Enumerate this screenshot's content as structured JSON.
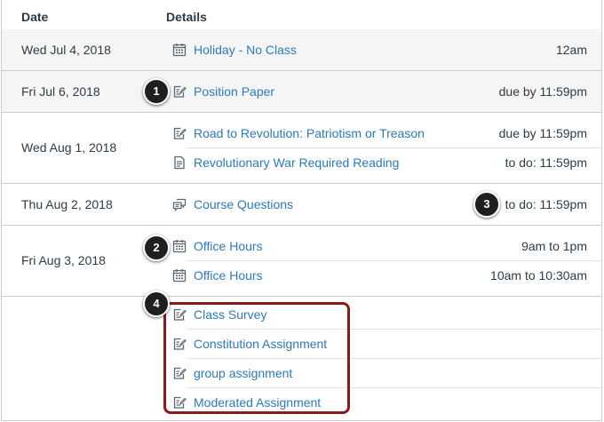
{
  "header": {
    "date_col": "Date",
    "details_col": "Details"
  },
  "rows": [
    {
      "date": "Wed Jul 4, 2018",
      "items": [
        {
          "icon": "calendar-icon",
          "title": "Holiday - No Class",
          "due": "12am"
        }
      ]
    },
    {
      "date": "Fri Jul 6, 2018",
      "items": [
        {
          "icon": "assignment-icon",
          "title": "Position Paper",
          "due": "due by 11:59pm"
        }
      ]
    },
    {
      "date": "Wed Aug 1, 2018",
      "items": [
        {
          "icon": "assignment-icon",
          "title": "Road to Revolution: Patriotism or Treason",
          "due": "due by 11:59pm"
        },
        {
          "icon": "page-icon",
          "title": "Revolutionary War Required Reading",
          "due": "to do: 11:59pm"
        }
      ]
    },
    {
      "date": "Thu Aug 2, 2018",
      "items": [
        {
          "icon": "discussion-icon",
          "title": "Course Questions",
          "due": "to do: 11:59pm"
        }
      ]
    },
    {
      "date": "Fri Aug 3, 2018",
      "items": [
        {
          "icon": "calendar-icon",
          "title": "Office Hours",
          "due": "9am to 1pm"
        },
        {
          "icon": "calendar-icon",
          "title": "Office Hours",
          "due": "10am to 10:30am"
        }
      ]
    },
    {
      "date": "",
      "items": [
        {
          "icon": "assignment-icon",
          "title": "Class Survey",
          "due": ""
        },
        {
          "icon": "assignment-icon",
          "title": "Constitution Assignment",
          "due": ""
        },
        {
          "icon": "assignment-icon",
          "title": "group assignment",
          "due": ""
        },
        {
          "icon": "assignment-icon",
          "title": "Moderated Assignment",
          "due": ""
        }
      ]
    }
  ],
  "callouts": [
    "1",
    "2",
    "3",
    "4"
  ],
  "colors": {
    "link": "#2b7abc",
    "text": "#2d3b45",
    "highlight": "#8b1a1a",
    "shaded_row": "#f5f5f5"
  }
}
